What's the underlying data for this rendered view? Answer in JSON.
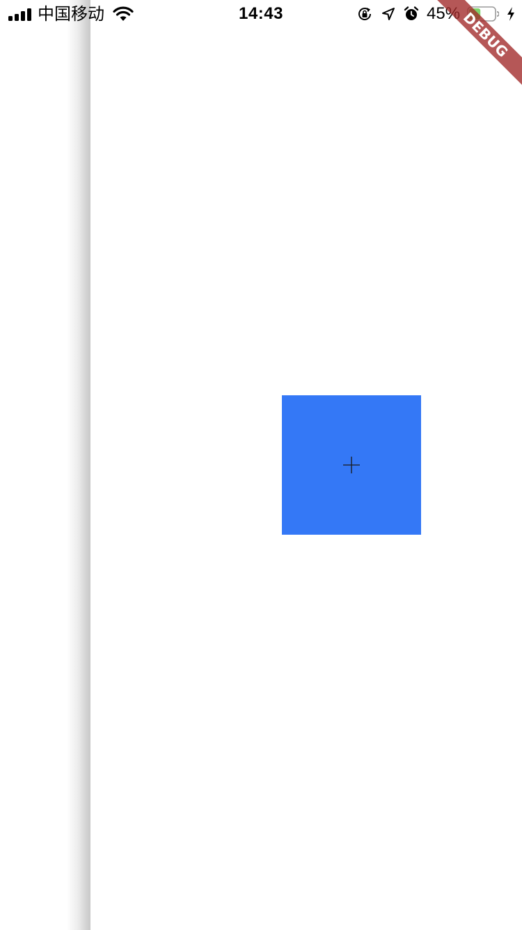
{
  "status_bar": {
    "carrier": "中国移动",
    "time": "14:43",
    "battery_percent": "45%",
    "battery_level": 0.45,
    "icons": [
      "signal-icon",
      "wifi-icon",
      "orientation-lock-icon",
      "location-icon",
      "alarm-icon",
      "battery-icon",
      "charging-icon"
    ]
  },
  "debug_banner": {
    "label": "DEBUG"
  },
  "content": {
    "box_color": "#3478f6",
    "box_icon": "plus-icon"
  }
}
